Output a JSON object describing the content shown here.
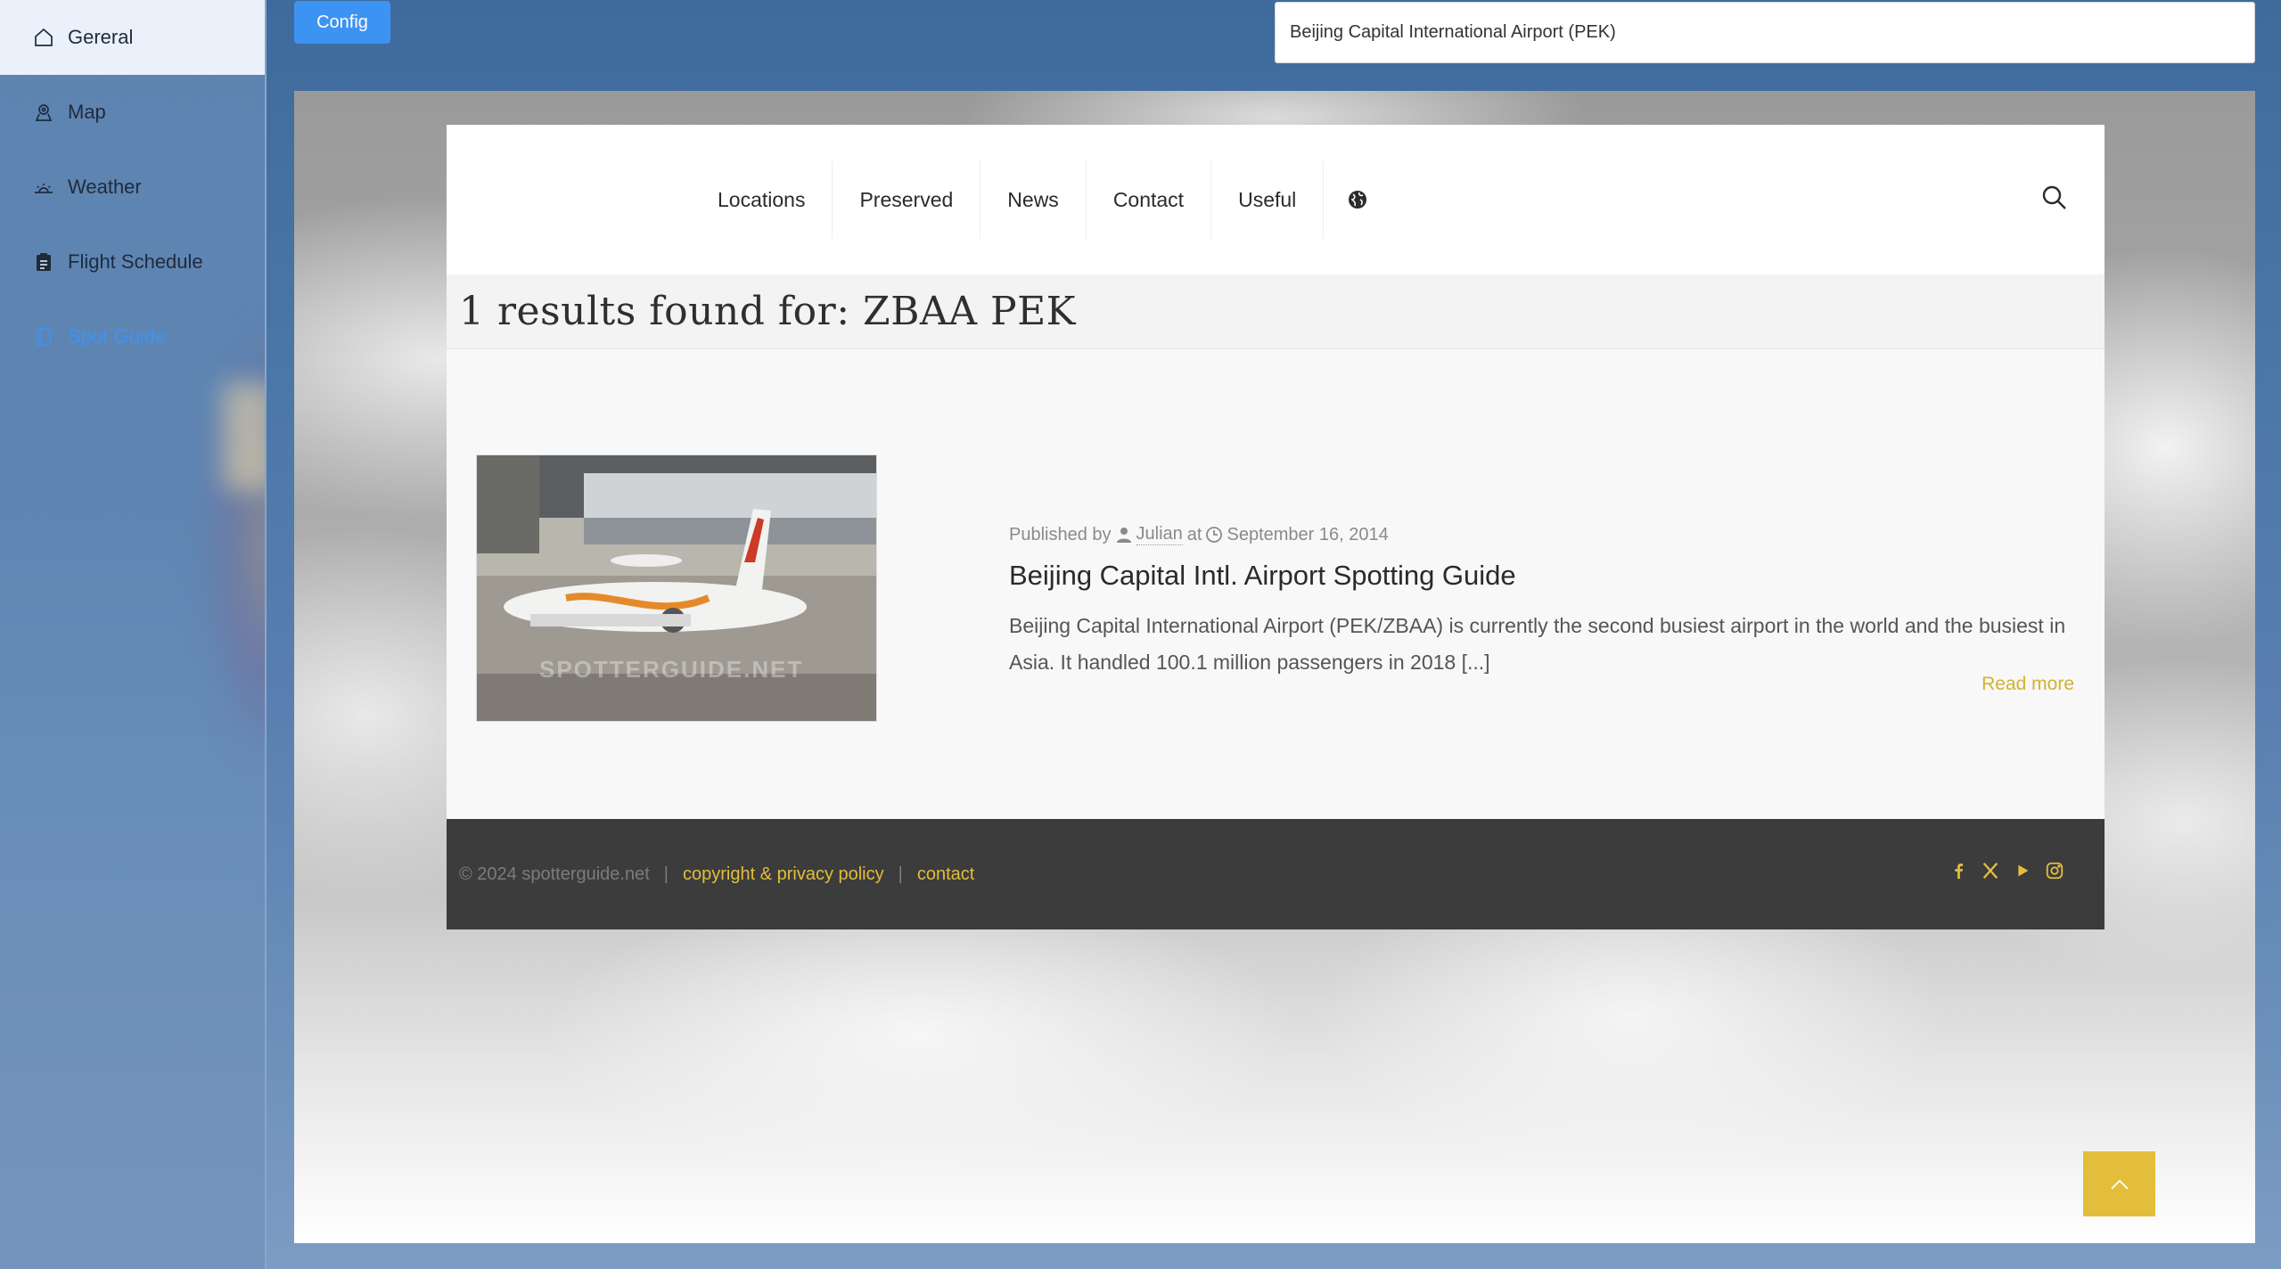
{
  "sidebar": {
    "items": [
      {
        "label": "Gereral",
        "icon": "home-icon"
      },
      {
        "label": "Map",
        "icon": "map-pin-icon"
      },
      {
        "label": "Weather",
        "icon": "sunrise-icon"
      },
      {
        "label": "Flight Schedule",
        "icon": "clipboard-icon"
      },
      {
        "label": "Spot Guide",
        "icon": "book-icon"
      }
    ],
    "active_index": 0,
    "selected_index": 4
  },
  "topbar": {
    "config_label": "Config",
    "airport_value": "Beijing Capital International Airport (PEK)"
  },
  "site": {
    "nav": [
      "Locations",
      "Preserved",
      "News",
      "Contact",
      "Useful"
    ],
    "results_title": "1 results found for: ZBAA PEK",
    "post": {
      "published_by": "Published by",
      "author": "Julian",
      "at": "at",
      "date": "September 16, 2014",
      "title": "Beijing Capital Intl. Airport Spotting Guide",
      "excerpt": "Beijing Capital International Airport (PEK/ZBAA) is currently the second busiest airport in the world and the busiest in Asia. It handled 100.1 million passengers in 2018 [...]",
      "read_more": "Read more",
      "thumb_watermark": "SPOTTERGUIDE.NET"
    },
    "footer": {
      "copyright": "© 2024 spotterguide.net",
      "sep": "|",
      "privacy": "copyright & privacy policy",
      "contact": "contact"
    }
  },
  "colors": {
    "accent_blue": "#3d93f2",
    "accent_gold": "#e2be3c",
    "footer_bg": "#3c3c3c"
  }
}
